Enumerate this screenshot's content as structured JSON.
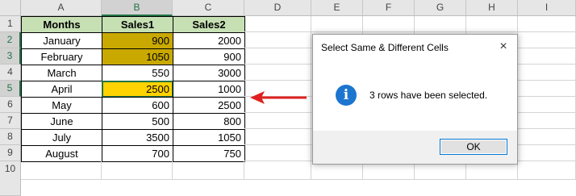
{
  "sheet": {
    "columns": [
      "A",
      "B",
      "C",
      "D",
      "E",
      "F",
      "G",
      "H",
      "I"
    ],
    "rows": [
      "1",
      "2",
      "3",
      "4",
      "5",
      "6",
      "7",
      "8",
      "9",
      "10"
    ],
    "headers": {
      "months": "Months",
      "sales1": "Sales1",
      "sales2": "Sales2"
    },
    "data": [
      {
        "month": "January",
        "sales1": "900",
        "sales2": "2000"
      },
      {
        "month": "February",
        "sales1": "1050",
        "sales2": "900"
      },
      {
        "month": "March",
        "sales1": "550",
        "sales2": "3000"
      },
      {
        "month": "April",
        "sales1": "2500",
        "sales2": "1000"
      },
      {
        "month": "May",
        "sales1": "600",
        "sales2": "2500"
      },
      {
        "month": "June",
        "sales1": "500",
        "sales2": "800"
      },
      {
        "month": "July",
        "sales1": "3500",
        "sales2": "1050"
      },
      {
        "month": "August",
        "sales1": "700",
        "sales2": "750"
      }
    ],
    "colors": {
      "header_fill": "#c6e0b4",
      "highlight_dark": "#c9a900",
      "highlight_bright": "#ffd200",
      "arrow": "#e02020"
    }
  },
  "dialog": {
    "title": "Select Same & Different Cells",
    "close_icon": "×",
    "info_icon": "i",
    "message": "3 rows have been selected.",
    "ok_label": "OK"
  }
}
